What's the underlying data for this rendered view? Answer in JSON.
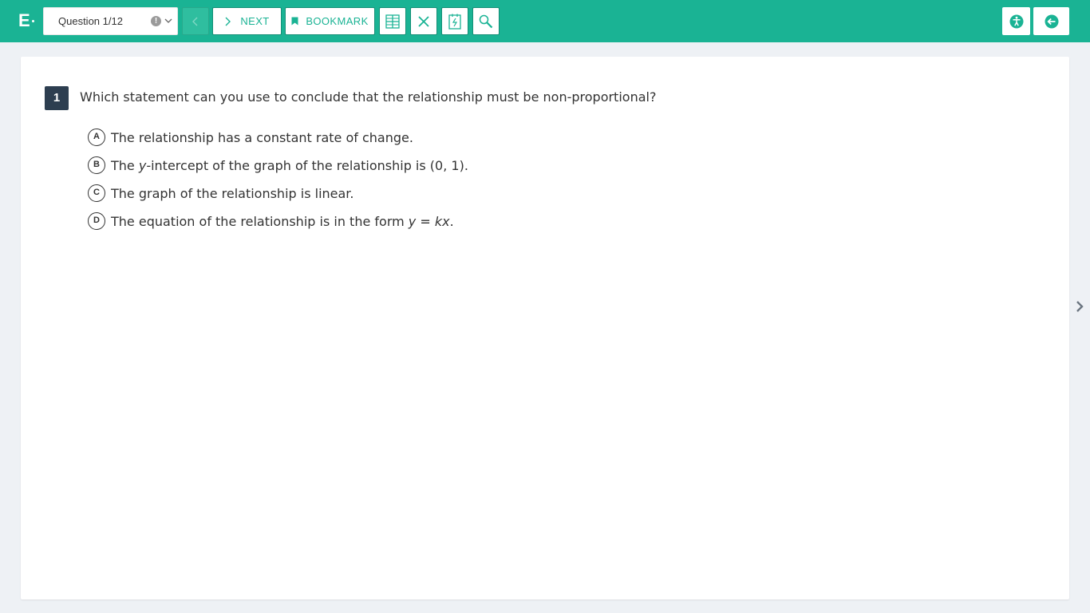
{
  "app": {
    "logo_letter": "E"
  },
  "toolbar": {
    "question_select": "Question 1/12",
    "flag_glyph": "!",
    "next_label": "NEXT",
    "bookmark_label": "BOOKMARK",
    "icons": [
      "grid-icon",
      "close-icon",
      "calculator-icon",
      "magnifier-icon"
    ],
    "right_icons": [
      "accessibility-icon",
      "exit-icon"
    ],
    "colors": {
      "bar": "#1ab394",
      "accent": "#1ab394"
    }
  },
  "question": {
    "number": "1",
    "text": "Which statement can you use to conclude that the relationship must be non-proportional?",
    "choices": [
      {
        "letter": "A",
        "pre": "The relationship has a constant rate of change.",
        "italic": "",
        "post": "",
        "italic2": "",
        "post2": ""
      },
      {
        "letter": "B",
        "pre": "The ",
        "italic": "y",
        "post": "-intercept of the graph of the relationship is (0, 1).",
        "italic2": "",
        "post2": ""
      },
      {
        "letter": "C",
        "pre": "The graph of the relationship is linear.",
        "italic": "",
        "post": "",
        "italic2": "",
        "post2": ""
      },
      {
        "letter": "D",
        "pre": "The equation of the relationship is in the form ",
        "italic": "y",
        "post": " = ",
        "italic2": "kx",
        "post2": "."
      }
    ]
  }
}
